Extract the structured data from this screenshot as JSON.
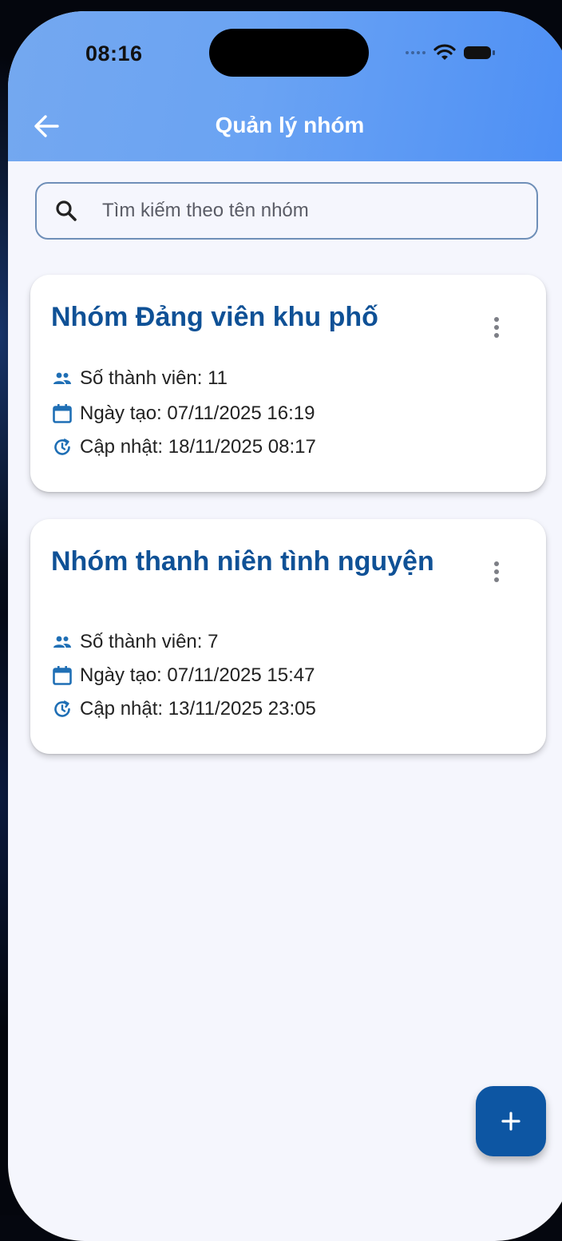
{
  "status_bar": {
    "time": "08:16"
  },
  "header": {
    "title": "Quản lý nhóm",
    "back_icon": "arrow-left-icon"
  },
  "search": {
    "placeholder": "Tìm kiếm theo tên nhóm",
    "value": "",
    "icon": "search-icon"
  },
  "groups": [
    {
      "name": "Nhóm Đảng viên khu phố",
      "members": "Số thành viên: 11",
      "created": "Ngày tạo: 07/11/2025 16:19",
      "updated": "Cập nhật: 18/11/2025 08:17"
    },
    {
      "name": "Nhóm thanh niên tình nguyện",
      "members": "Số thành viên: 7",
      "created": "Ngày tạo: 07/11/2025 15:47",
      "updated": "Cập nhật: 13/11/2025 23:05"
    }
  ],
  "fab": {
    "icon": "plus-icon"
  },
  "colors": {
    "header_gradient_start": "#74a8f0",
    "header_gradient_end": "#4d8ff5",
    "title_blue": "#0f5196",
    "icon_blue": "#1f6fb5",
    "fab_blue": "#0d56a3",
    "background": "#f5f6fd"
  }
}
